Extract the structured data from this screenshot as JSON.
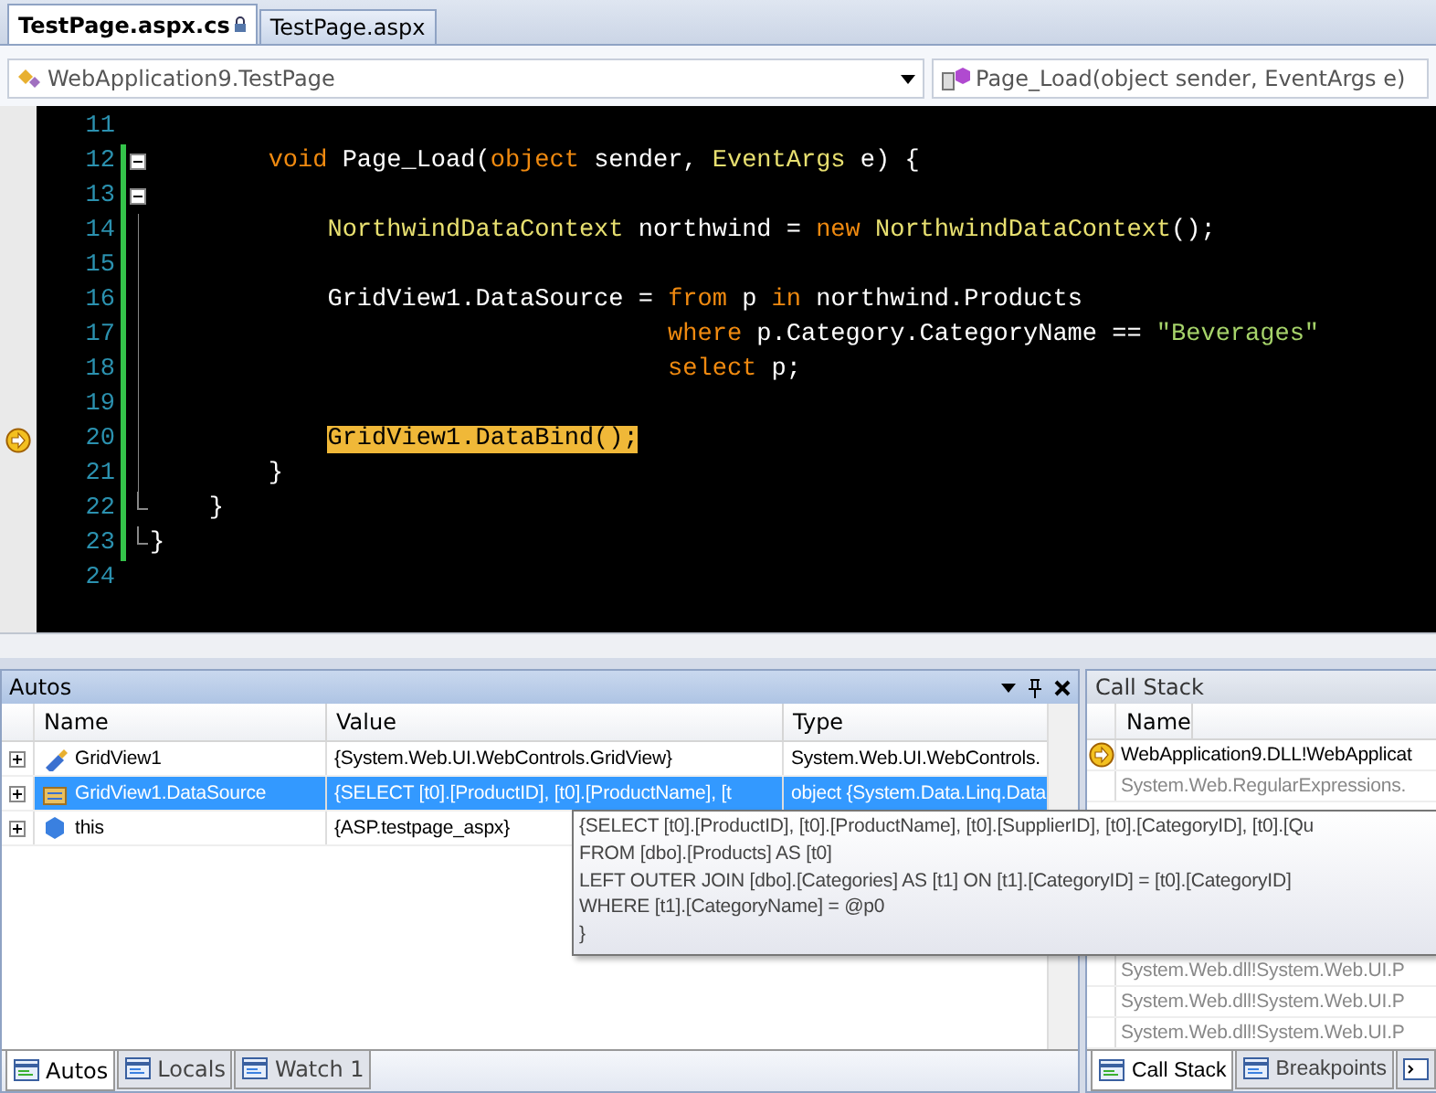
{
  "document_tabs": [
    {
      "label": "TestPage.aspx.cs",
      "selected": true,
      "locked": true
    },
    {
      "label": "TestPage.aspx",
      "selected": false,
      "locked": false
    }
  ],
  "navigation": {
    "type_dropdown": "WebApplication9.TestPage",
    "member_dropdown": "Page_Load(object sender, EventArgs e)"
  },
  "code": {
    "lines": [
      {
        "number": "11",
        "current": false,
        "collapsible": false,
        "fold_end": false
      },
      {
        "number": "12",
        "current": false,
        "collapsible": true,
        "fold_end": false,
        "tokens": [
          {
            "kind": "keyword",
            "text": "        void"
          },
          {
            "kind": "plain",
            "text": " Page_Load("
          },
          {
            "kind": "keyword",
            "text": "object"
          },
          {
            "kind": "plain",
            "text": " sender, "
          },
          {
            "kind": "type",
            "text": "EventArgs"
          },
          {
            "kind": "plain",
            "text": " e) {"
          }
        ]
      },
      {
        "number": "13",
        "current": false,
        "collapsible": true,
        "fold_end": false
      },
      {
        "number": "14",
        "current": false,
        "collapsible": false,
        "fold_end": false,
        "tokens": [
          {
            "kind": "type",
            "text": "            NorthwindDataContext"
          },
          {
            "kind": "plain",
            "text": " northwind = "
          },
          {
            "kind": "keyword",
            "text": "new"
          },
          {
            "kind": "type",
            "text": " NorthwindDataContext"
          },
          {
            "kind": "plain",
            "text": "();"
          }
        ]
      },
      {
        "number": "15",
        "current": false,
        "collapsible": false,
        "fold_end": false
      },
      {
        "number": "16",
        "current": false,
        "collapsible": false,
        "fold_end": false,
        "tokens": [
          {
            "kind": "plain",
            "text": "            GridView1.DataSource = "
          },
          {
            "kind": "keyword",
            "text": "from"
          },
          {
            "kind": "plain",
            "text": " p "
          },
          {
            "kind": "keyword",
            "text": "in"
          },
          {
            "kind": "plain",
            "text": " northwind.Products"
          }
        ]
      },
      {
        "number": "17",
        "current": false,
        "collapsible": false,
        "fold_end": false,
        "tokens": [
          {
            "kind": "keyword",
            "text": "                                   where"
          },
          {
            "kind": "plain",
            "text": " p.Category.CategoryName == "
          },
          {
            "kind": "string",
            "text": "\"Beverages\""
          }
        ]
      },
      {
        "number": "18",
        "current": false,
        "collapsible": false,
        "fold_end": false,
        "tokens": [
          {
            "kind": "keyword",
            "text": "                                   select"
          },
          {
            "kind": "plain",
            "text": " p;"
          }
        ]
      },
      {
        "number": "19",
        "current": false,
        "collapsible": false,
        "fold_end": false
      },
      {
        "number": "20",
        "current": true,
        "collapsible": false,
        "fold_end": false,
        "tokens": [
          {
            "kind": "plain",
            "text": "            GridView1.DataBind();"
          }
        ]
      },
      {
        "number": "21",
        "current": false,
        "collapsible": false,
        "fold_end": false,
        "tokens": [
          {
            "kind": "plain",
            "text": "        }"
          }
        ]
      },
      {
        "number": "22",
        "current": false,
        "collapsible": false,
        "fold_end": true,
        "tokens": [
          {
            "kind": "plain",
            "text": "    }"
          }
        ]
      },
      {
        "number": "23",
        "current": false,
        "collapsible": false,
        "fold_end": true,
        "tokens": [
          {
            "kind": "plain",
            "text": "}"
          }
        ]
      },
      {
        "number": "24",
        "current": false,
        "collapsible": false,
        "fold_end": false
      }
    ]
  },
  "autos": {
    "title": "Autos",
    "columns": [
      "Name",
      "Value",
      "Type"
    ],
    "rows": [
      {
        "name": "GridView1",
        "value": "{System.Web.UI.WebControls.GridView}",
        "type": "System.Web.UI.WebControls.",
        "selected": false
      },
      {
        "name": "GridView1.DataSource",
        "value": "{SELECT [t0].[ProductID], [t0].[ProductName], [t",
        "type": "object {System.Data.Linq.Data",
        "selected": true
      },
      {
        "name": "this",
        "value": "{ASP.testpage_aspx}",
        "selected": false
      }
    ],
    "tooltip": {
      "lines": [
        "{SELECT [t0].[ProductID], [t0].[ProductName], [t0].[SupplierID], [t0].[CategoryID], [t0].[Qu",
        "FROM [dbo].[Products] AS [t0]",
        "LEFT OUTER JOIN [dbo].[Categories] AS [t1] ON [t1].[CategoryID] = [t0].[CategoryID]",
        "WHERE [t1].[CategoryName] = @p0",
        "}"
      ]
    }
  },
  "autos_tabs": [
    {
      "label": "Autos",
      "selected": true
    },
    {
      "label": "Locals",
      "selected": false
    },
    {
      "label": "Watch 1",
      "selected": false
    }
  ],
  "call_stack": {
    "title": "Call Stack",
    "columns": [
      "Name"
    ],
    "rows": [
      {
        "name": "WebApplication9.DLL!WebApplicat",
        "current": true
      },
      {
        "name": "System.Web.RegularExpressions.",
        "current": false
      },
      {
        "name": "System.Web.dll!System.Web.UI.P",
        "current": false
      },
      {
        "name": "System.Web.dll!System.Web.UI.P",
        "current": false
      },
      {
        "name": "System.Web.dll!System.Web.UI.P",
        "current": false
      }
    ]
  },
  "call_stack_tabs": [
    {
      "label": "Call Stack",
      "selected": true
    },
    {
      "label": "Breakpoints",
      "selected": false
    }
  ]
}
